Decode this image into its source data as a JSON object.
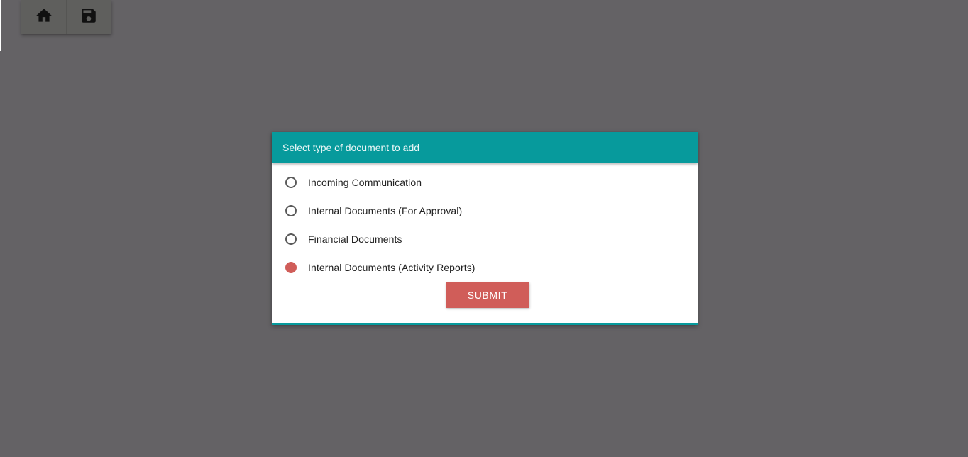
{
  "toolbar": {
    "buttons": [
      {
        "icon": "home-icon"
      },
      {
        "icon": "save-icon"
      }
    ]
  },
  "dialog": {
    "title": "Select type of document to add",
    "options": [
      {
        "label": "Incoming Communication",
        "selected": false
      },
      {
        "label": "Internal Documents (For Approval)",
        "selected": false
      },
      {
        "label": "Financial Documents",
        "selected": false
      },
      {
        "label": "Internal Documents (Activity Reports)",
        "selected": true
      }
    ],
    "submit_label": "SUBMIT"
  },
  "colors": {
    "backdrop": "#646265",
    "header": "#079a9c",
    "accent": "#d05d59"
  }
}
